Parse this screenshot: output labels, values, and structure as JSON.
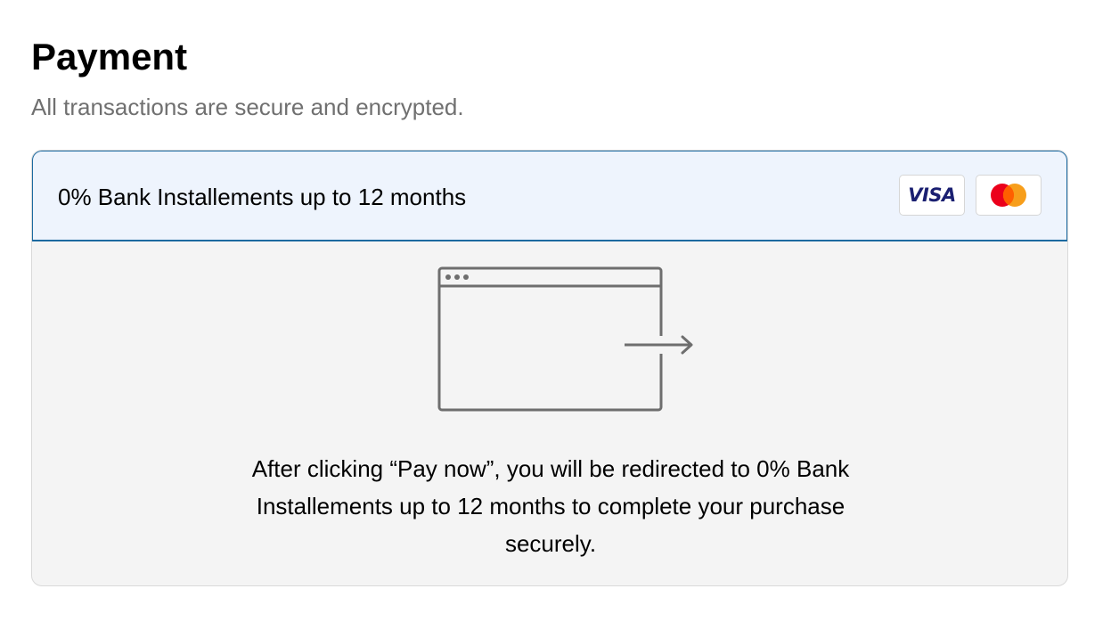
{
  "header": {
    "title": "Payment",
    "subtitle": "All transactions are secure and encrypted."
  },
  "payment_option": {
    "label": "0% Bank Installements up to 12 months",
    "selected": true,
    "accepted_cards": [
      {
        "name": "VISA",
        "icon": "visa-logo"
      },
      {
        "name": "Mastercard",
        "icon": "mastercard-logo"
      }
    ],
    "illustration_icon": "browser-redirect-icon",
    "redirect_message": "After clicking “Pay now”, you will be redirected to 0% Bank Installements up to 12 months to complete your purchase securely."
  },
  "colors": {
    "accent_border": "#1c6aa0",
    "header_background": "#eef4fd",
    "panel_background": "#f4f4f4",
    "subtitle_text": "#707070",
    "visa_blue": "#1a1f71",
    "mastercard_red": "#eb001b",
    "mastercard_orange": "#f79e1b",
    "mastercard_overlap": "#ff5f00"
  }
}
